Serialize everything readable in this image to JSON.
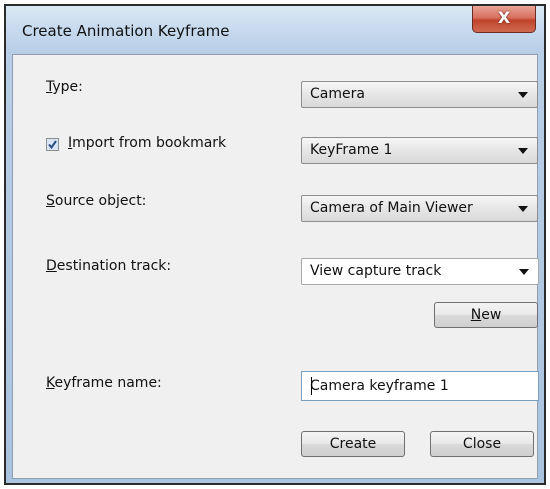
{
  "window": {
    "title": "Create Animation Keyframe",
    "close_glyph": "X"
  },
  "fields": {
    "type": {
      "label_accel": "T",
      "label_rest": "ype:",
      "value": "Camera"
    },
    "import": {
      "label_accel": "I",
      "label_rest": "mport from bookmark",
      "checked": true,
      "value": "KeyFrame 1"
    },
    "source": {
      "label_accel": "S",
      "label_rest": "ource object:",
      "value": "Camera of Main Viewer"
    },
    "destination": {
      "label_accel": "D",
      "label_rest": "estination track:",
      "value": "View capture track"
    },
    "keyframe_name": {
      "label_accel": "K",
      "label_rest": "eyframe name:",
      "value": "Camera keyframe 1"
    }
  },
  "buttons": {
    "new_accel": "N",
    "new_rest": "ew",
    "create": "Create",
    "close": "Close"
  },
  "icons": [
    "close-icon",
    "checkmark-icon",
    "dropdown-arrow-icon"
  ],
  "colors": {
    "close_button": "#c9503a",
    "title_bar": "#c7daee",
    "client_bg": "#f0f0f0"
  }
}
